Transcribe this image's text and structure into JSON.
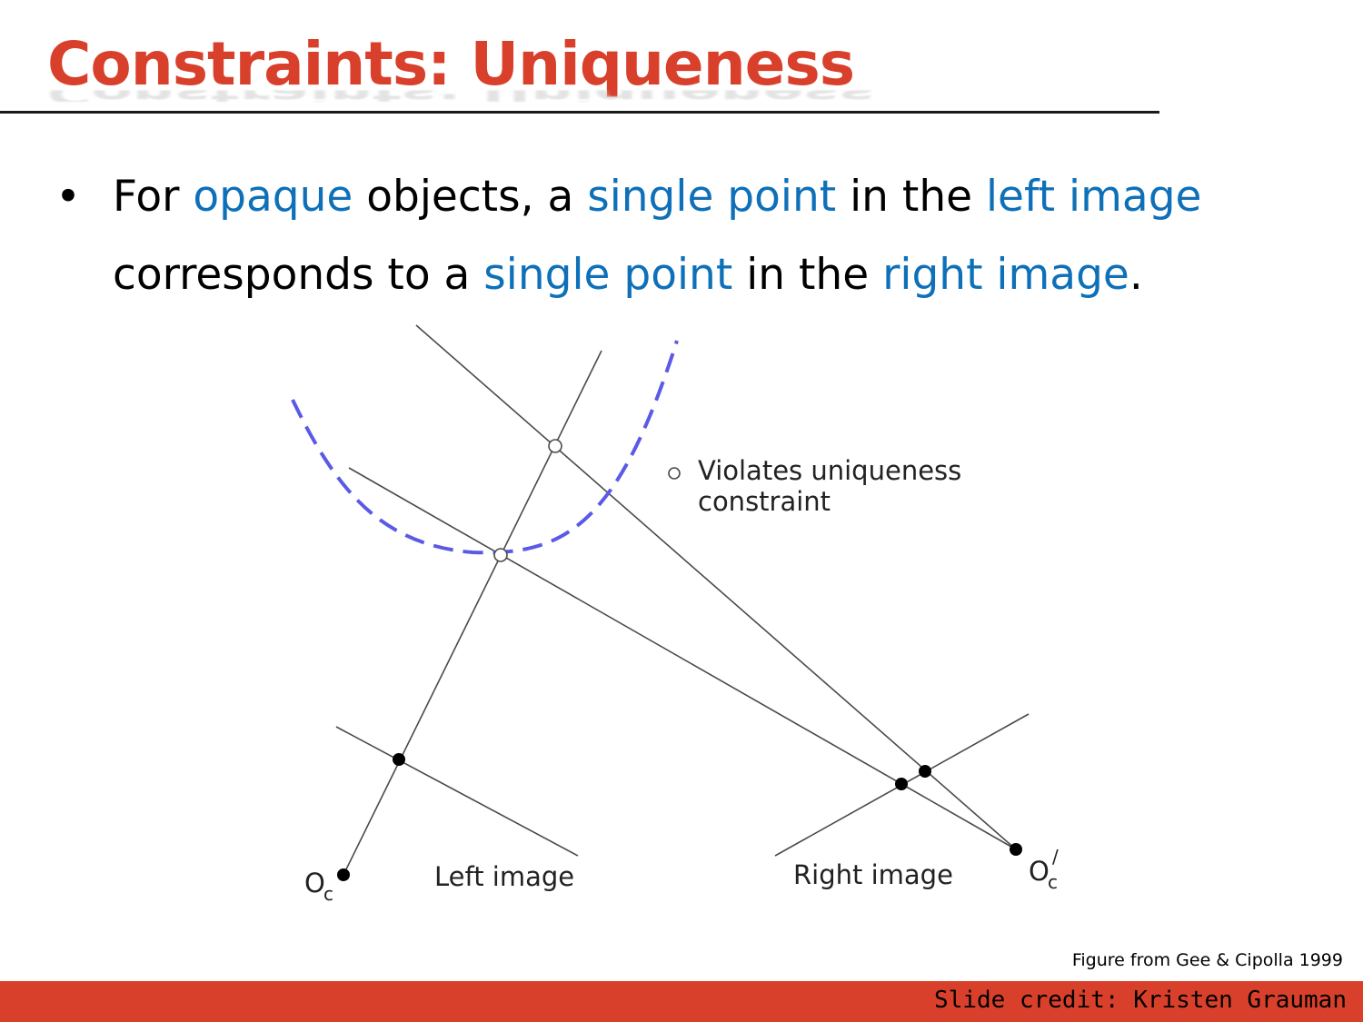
{
  "slide": {
    "title": "Constraints: Uniqueness",
    "bullet": {
      "symbol": "•",
      "segments": [
        {
          "text": "For ",
          "highlight": false
        },
        {
          "text": "opaque",
          "highlight": true
        },
        {
          "text": " objects, a ",
          "highlight": false
        },
        {
          "text": "single point",
          "highlight": true
        },
        {
          "text": " in the ",
          "highlight": false
        },
        {
          "text": "left image",
          "highlight": true
        },
        {
          "text": " corresponds to a ",
          "highlight": false
        },
        {
          "text": "single point",
          "highlight": true
        },
        {
          "text": " in the ",
          "highlight": false
        },
        {
          "text": "right image",
          "highlight": true
        },
        {
          "text": ".",
          "highlight": false
        }
      ]
    },
    "figure_credit": "Figure from Gee & Cipolla 1999",
    "slide_credit": "Slide credit: Kristen Grauman"
  },
  "diagram": {
    "legend_line1": "Violates uniqueness",
    "legend_line2": "constraint",
    "left_image_label": "Left image",
    "right_image_label": "Right image",
    "left_center_label": "O",
    "left_center_sub": "c",
    "right_center_label": "O",
    "right_center_sub": "c",
    "right_center_prime": "/"
  },
  "colors": {
    "title": "#d9402b",
    "highlight": "#0e70b8",
    "footer_bar": "#d9402b",
    "surface_curve": "#5a5ae6",
    "diagram_lines": "#4a4a4a"
  }
}
